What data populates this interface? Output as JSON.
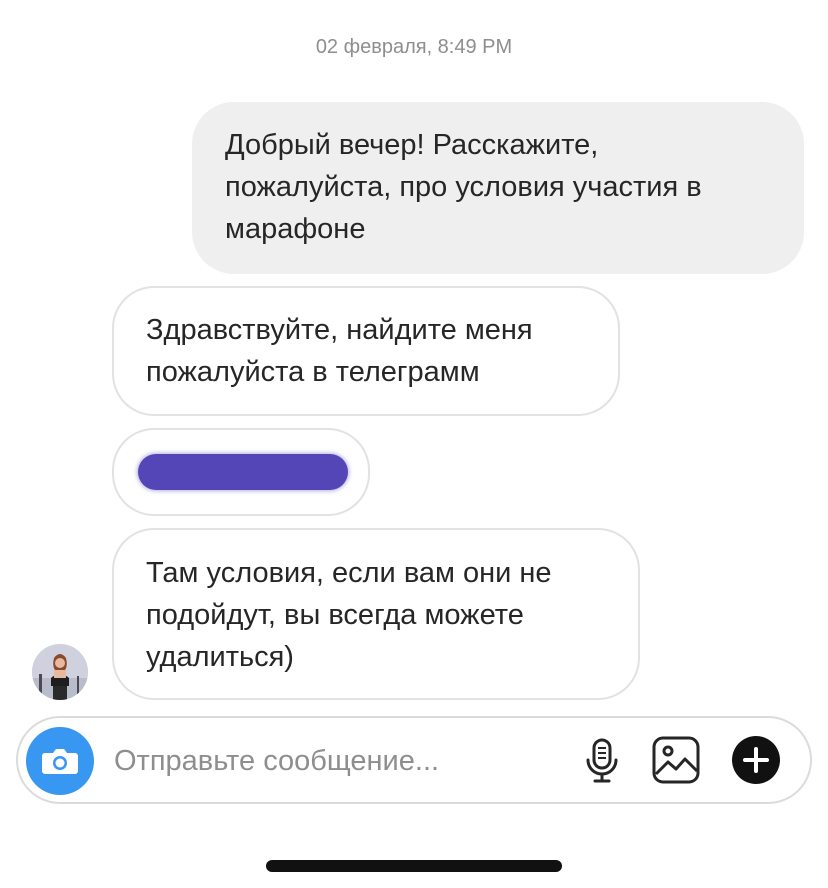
{
  "thread": {
    "timestamp": "02 февраля, 8:49 PM"
  },
  "messages": [
    {
      "direction": "outgoing",
      "text": "Добрый вечер! Расскажите,\nпожалуйста, про условия участия в\nмарафоне"
    },
    {
      "direction": "incoming",
      "text": "Здравствуйте, найдите меня\nпожалуйста в телеграмм"
    },
    {
      "direction": "incoming",
      "text": "",
      "redacted": true,
      "redaction_color": "#5546b8"
    },
    {
      "direction": "incoming",
      "text": "Там условия, если вам они не\nподойдут, вы всегда можете\nудалиться)"
    }
  ],
  "composer": {
    "value": "",
    "placeholder": "Отправьте сообщение...",
    "accent_color": "#3897f0",
    "icons": [
      "camera-icon",
      "microphone-icon",
      "gallery-icon",
      "plus-icon"
    ]
  }
}
